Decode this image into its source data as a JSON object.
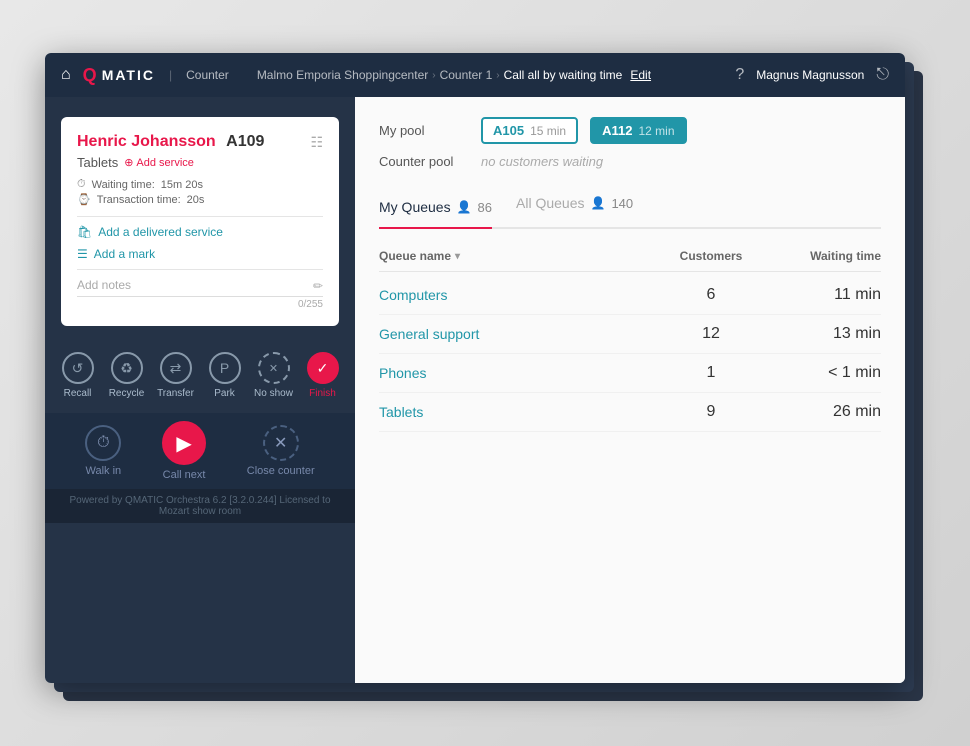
{
  "nav": {
    "brand_q": "Q",
    "brand_text": "MATIC",
    "nav_label": "Counter",
    "breadcrumb": {
      "org": "Malmo Emporia Shoppingcenter",
      "counter": "Counter 1",
      "mode": "Call all by waiting time",
      "edit": "Edit"
    },
    "user": "Magnus Magnusson",
    "help_icon": "?",
    "logout_icon": "⎋"
  },
  "customer": {
    "name": "Henric Johansson",
    "ticket": "A109",
    "service": "Tablets",
    "add_service": "Add service",
    "waiting_time_label": "Waiting time:",
    "waiting_time": "15m 20s",
    "transaction_time_label": "Transaction time:",
    "transaction_time": "20s",
    "add_delivered": "Add a delivered service",
    "add_mark": "Add a mark",
    "notes_placeholder": "Add notes",
    "notes_count": "0/255"
  },
  "actions": [
    {
      "id": "recall",
      "label": "Recall",
      "icon": "↺"
    },
    {
      "id": "recycle",
      "label": "Recycle",
      "icon": "♻"
    },
    {
      "id": "transfer",
      "label": "Transfer",
      "icon": "⇄"
    },
    {
      "id": "park",
      "label": "Park",
      "icon": "P"
    },
    {
      "id": "no_show",
      "label": "No show",
      "icon": "✕"
    },
    {
      "id": "finish",
      "label": "Finish",
      "icon": "✓",
      "active": true
    }
  ],
  "bottom_actions": [
    {
      "id": "walk_in",
      "label": "Walk in",
      "icon": "⏱"
    },
    {
      "id": "call_next",
      "label": "Call next",
      "icon": "▶",
      "primary": true
    },
    {
      "id": "close_counter",
      "label": "Close counter",
      "icon": "✕"
    }
  ],
  "footer": "Powered by QMATIC Orchestra 6.2 [3.2.0.244]  Licensed to Mozart show room",
  "right_panel": {
    "my_pool_label": "My pool",
    "counter_pool_label": "Counter pool",
    "pool_tickets": [
      {
        "id": "A105",
        "time": "15 min",
        "active": false
      },
      {
        "id": "A112",
        "time": "12 min",
        "active": true
      }
    ],
    "no_customers": "no customers waiting",
    "tabs": [
      {
        "id": "my_queues",
        "label": "My Queues",
        "count": "86"
      },
      {
        "id": "all_queues",
        "label": "All Queues",
        "count": "140"
      }
    ],
    "table": {
      "col_name": "Queue name",
      "col_customers": "Customers",
      "col_waiting": "Waiting time",
      "rows": [
        {
          "name": "Computers",
          "customers": "6",
          "waiting": "11 min"
        },
        {
          "name": "General support",
          "customers": "12",
          "waiting": "13 min"
        },
        {
          "name": "Phones",
          "customers": "1",
          "waiting": "< 1 min"
        },
        {
          "name": "Tablets",
          "customers": "9",
          "waiting": "26 min"
        }
      ]
    }
  }
}
